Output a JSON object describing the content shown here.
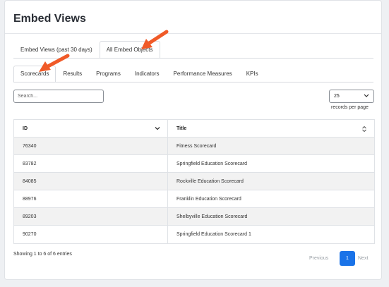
{
  "page": {
    "title": "Embed Views"
  },
  "tabs_top": [
    {
      "label": "Embed Views (past 30 days)",
      "active": false
    },
    {
      "label": "All Embed Objects",
      "active": true
    }
  ],
  "tabs_sub": [
    {
      "label": "Scorecards",
      "active": true
    },
    {
      "label": "Results",
      "active": false
    },
    {
      "label": "Programs",
      "active": false
    },
    {
      "label": "Indicators",
      "active": false
    },
    {
      "label": "Performance Measures",
      "active": false
    },
    {
      "label": "KPIs",
      "active": false
    }
  ],
  "search": {
    "placeholder": "Search..."
  },
  "per_page": {
    "value": "25",
    "label": "records per page"
  },
  "table": {
    "columns": [
      "ID",
      "Title"
    ],
    "rows": [
      {
        "id": "76340",
        "title": "Fitness Scorecard"
      },
      {
        "id": "83782",
        "title": "Springfield Education Scorecard"
      },
      {
        "id": "84085",
        "title": "Rockville Education Scorecard"
      },
      {
        "id": "88976",
        "title": "Franklin Education Scorecard"
      },
      {
        "id": "89203",
        "title": "Shelbyville Education Scorecard"
      },
      {
        "id": "90270",
        "title": "Springfield Education Scorecard 1"
      }
    ]
  },
  "footer": {
    "info": "Showing 1 to 6 of 6 entries",
    "previous": "Previous",
    "current_page": "1",
    "next": "Next"
  },
  "colors": {
    "accent": "#1a73e8",
    "annotation_arrow": "#f05a28"
  },
  "icons": {
    "select_chevron": "chevron-down-icon",
    "sort": "sort-icon"
  }
}
